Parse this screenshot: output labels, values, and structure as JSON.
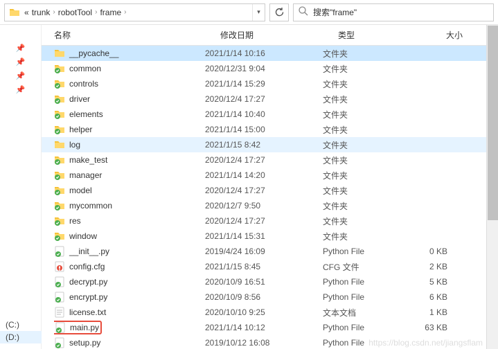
{
  "breadcrumb": {
    "prefix": "«",
    "parts": [
      "trunk",
      "robotTool",
      "frame"
    ]
  },
  "search": {
    "placeholder": "搜索\"frame\""
  },
  "columns": {
    "name": "名称",
    "date": "修改日期",
    "type": "类型",
    "size": "大小"
  },
  "drives": [
    "(C:)",
    "(D:)"
  ],
  "watermark": "https://blog.csdn.net/jiangsflam",
  "rows": [
    {
      "icon": "folder",
      "name": "__pycache__",
      "date": "2021/1/14 10:16",
      "type": "文件夹",
      "size": "",
      "state": "sel"
    },
    {
      "icon": "folder-badge",
      "name": "common",
      "date": "2020/12/31 9:04",
      "type": "文件夹",
      "size": ""
    },
    {
      "icon": "folder-badge",
      "name": "controls",
      "date": "2021/1/14 15:29",
      "type": "文件夹",
      "size": ""
    },
    {
      "icon": "folder-badge",
      "name": "driver",
      "date": "2020/12/4 17:27",
      "type": "文件夹",
      "size": ""
    },
    {
      "icon": "folder-badge",
      "name": "elements",
      "date": "2021/1/14 10:40",
      "type": "文件夹",
      "size": ""
    },
    {
      "icon": "folder-badge",
      "name": "helper",
      "date": "2021/1/14 15:00",
      "type": "文件夹",
      "size": ""
    },
    {
      "icon": "folder",
      "name": "log",
      "date": "2021/1/15 8:42",
      "type": "文件夹",
      "size": "",
      "state": "hov"
    },
    {
      "icon": "folder-badge",
      "name": "make_test",
      "date": "2020/12/4 17:27",
      "type": "文件夹",
      "size": ""
    },
    {
      "icon": "folder-badge",
      "name": "manager",
      "date": "2021/1/14 14:20",
      "type": "文件夹",
      "size": ""
    },
    {
      "icon": "folder-badge",
      "name": "model",
      "date": "2020/12/4 17:27",
      "type": "文件夹",
      "size": ""
    },
    {
      "icon": "folder-badge",
      "name": "mycommon",
      "date": "2020/12/7 9:50",
      "type": "文件夹",
      "size": ""
    },
    {
      "icon": "folder-badge",
      "name": "res",
      "date": "2020/12/4 17:27",
      "type": "文件夹",
      "size": ""
    },
    {
      "icon": "folder-badge",
      "name": "window",
      "date": "2021/1/14 15:31",
      "type": "文件夹",
      "size": ""
    },
    {
      "icon": "py",
      "name": "__init__.py",
      "date": "2019/4/24 16:09",
      "type": "Python File",
      "size": "0 KB"
    },
    {
      "icon": "cfg",
      "name": "config.cfg",
      "date": "2021/1/15 8:45",
      "type": "CFG 文件",
      "size": "2 KB"
    },
    {
      "icon": "py",
      "name": "decrypt.py",
      "date": "2020/10/9 16:51",
      "type": "Python File",
      "size": "5 KB"
    },
    {
      "icon": "py",
      "name": "encrypt.py",
      "date": "2020/10/9 8:56",
      "type": "Python File",
      "size": "6 KB"
    },
    {
      "icon": "txt",
      "name": "license.txt",
      "date": "2020/10/10 9:25",
      "type": "文本文档",
      "size": "1 KB"
    },
    {
      "icon": "py",
      "name": "main.py",
      "date": "2021/1/14 10:12",
      "type": "Python File",
      "size": "63 KB",
      "highlight": true
    },
    {
      "icon": "py",
      "name": "setup.py",
      "date": "2019/10/12 16:08",
      "type": "Python File",
      "size": ""
    }
  ]
}
